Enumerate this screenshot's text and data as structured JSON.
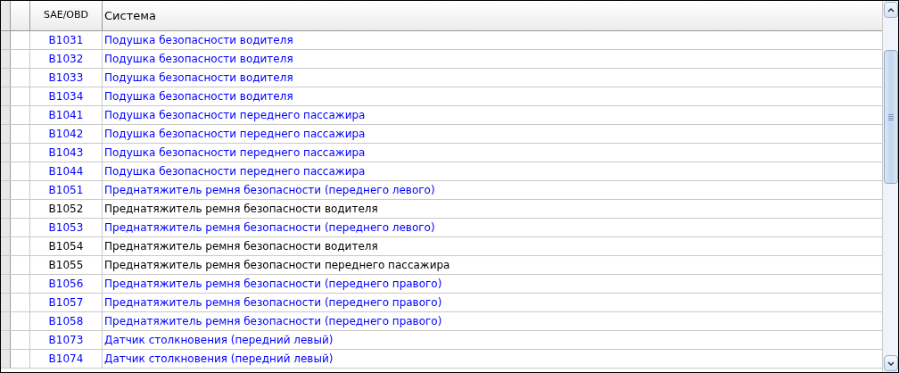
{
  "table": {
    "columns": [
      "SAE/OBD",
      "Система"
    ],
    "rows": [
      {
        "code": "B1031",
        "system": "Подушка безопасности водителя",
        "color": "#0000ff"
      },
      {
        "code": "B1032",
        "system": "Подушка безопасности водителя",
        "color": "#0000ff"
      },
      {
        "code": "B1033",
        "system": "Подушка безопасности водителя",
        "color": "#0000ff"
      },
      {
        "code": "B1034",
        "system": "Подушка безопасности водителя",
        "color": "#0000ff"
      },
      {
        "code": "B1041",
        "system": "Подушка безопасности переднего пассажира",
        "color": "#0000ff"
      },
      {
        "code": "B1042",
        "system": "Подушка безопасности переднего пассажира",
        "color": "#0000ff"
      },
      {
        "code": "B1043",
        "system": "Подушка безопасности переднего пассажира",
        "color": "#0000ff"
      },
      {
        "code": "B1044",
        "system": "Подушка безопасности переднего пассажира",
        "color": "#0000ff"
      },
      {
        "code": "B1051",
        "system": "Преднатяжитель ремня безопасности (переднего левого)",
        "color": "#0000ff"
      },
      {
        "code": "B1052",
        "system": "Преднатяжитель ремня безопасности водителя",
        "color": "#000000"
      },
      {
        "code": "B1053",
        "system": "Преднатяжитель ремня безопасности (переднего левого)",
        "color": "#0000ff"
      },
      {
        "code": "B1054",
        "system": "Преднатяжитель ремня безопасности водителя",
        "color": "#000000"
      },
      {
        "code": "B1055",
        "system": "Преднатяжитель ремня безопасности переднего пассажира",
        "color": "#000000"
      },
      {
        "code": "B1056",
        "system": "Преднатяжитель ремня безопасности (переднего правого)",
        "color": "#0000ff"
      },
      {
        "code": "B1057",
        "system": "Преднатяжитель ремня безопасности (переднего правого)",
        "color": "#0000ff"
      },
      {
        "code": "B1058",
        "system": "Преднатяжитель ремня безопасности (переднего правого)",
        "color": "#0000ff"
      },
      {
        "code": "B1073",
        "system": "Датчик столкновения (передний левый)",
        "color": "#0000ff"
      },
      {
        "code": "B1074",
        "system": "Датчик столкновения (передний левый)",
        "color": "#0000ff"
      }
    ]
  }
}
